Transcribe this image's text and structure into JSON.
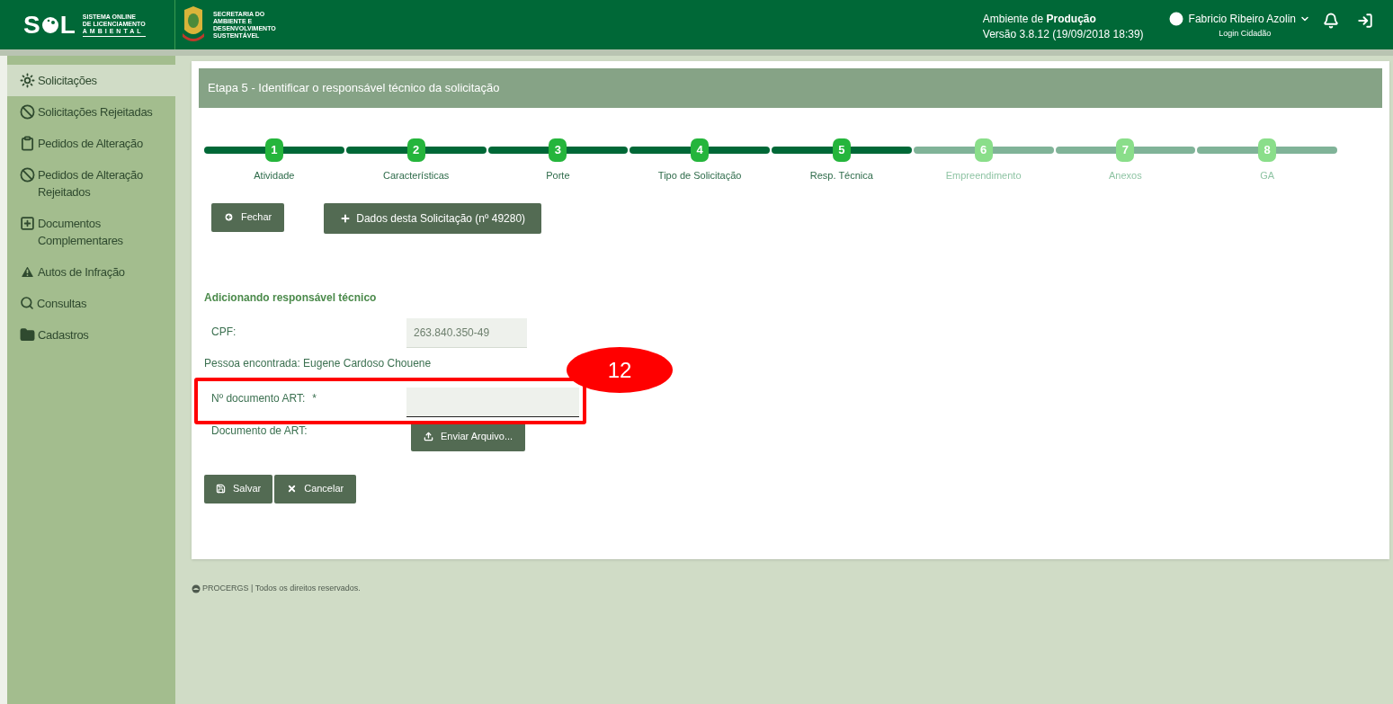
{
  "header": {
    "logo": {
      "left": "S",
      "right": "L",
      "tagline": [
        "SISTEMA ONLINE",
        "DE LICENCIAMENTO",
        "AMBIENTAL"
      ]
    },
    "secretaria": [
      "SECRETARIA DO",
      "AMBIENTE E",
      "DESENVOLVIMENTO",
      "SUSTENTÁVEL"
    ],
    "environment": "Ambiente de **Produção**",
    "version": "Versão 3.8.12 (19/09/2018 18:39)",
    "user": {
      "name": "Fabricio Ribeiro Azolin",
      "login": "Login Cidadão"
    }
  },
  "sidebar": {
    "items": [
      {
        "label": "Solicitações",
        "selected": true
      },
      {
        "label": "Solicitações Rejeitadas",
        "selected": false
      },
      {
        "label": "Pedidos de Alteração",
        "selected": false
      },
      {
        "label": "Pedidos de Alteração Rejeitados",
        "selected": false
      },
      {
        "label": "Documentos Complementares",
        "selected": false
      },
      {
        "label": "Autos de Infração",
        "selected": false
      },
      {
        "label": "Consultas",
        "selected": false
      },
      {
        "label": "Cadastros",
        "selected": false
      }
    ]
  },
  "page_title": "Etapa 5 - Identificar o responsável técnico da solicitação",
  "steps": [
    {
      "number": "1",
      "label": "Atividade",
      "completed": true
    },
    {
      "number": "2",
      "label": "Características",
      "completed": true
    },
    {
      "number": "3",
      "label": "Porte",
      "completed": true
    },
    {
      "number": "4",
      "label": "Tipo de Solicitação",
      "completed": true
    },
    {
      "number": "5",
      "label": "Resp. Técnica",
      "completed": true
    },
    {
      "number": "6",
      "label": "Empreendimento",
      "completed": false
    },
    {
      "number": "7",
      "label": "Anexos",
      "completed": false
    },
    {
      "number": "8",
      "label": "GA",
      "completed": false
    }
  ],
  "actions": {
    "close": "Fechar",
    "details": "Dados desta Solicitação (nº 49280)"
  },
  "form": {
    "heading": "Adicionando responsável técnico",
    "cpf": {
      "label": "CPF:",
      "value": "263.840.350-49"
    },
    "found": "Pessoa encontrada: Eugene Cardoso Chouene",
    "art": {
      "label": "Nº documento ART:",
      "required": "*"
    },
    "file": {
      "label": "Documento de ART:",
      "button": "Enviar Arquivo..."
    },
    "save": "Salvar",
    "cancel": "Cancelar"
  },
  "annotation": {
    "label": "12"
  },
  "footer": "PROCERGS | Todos os direitos reservados."
}
